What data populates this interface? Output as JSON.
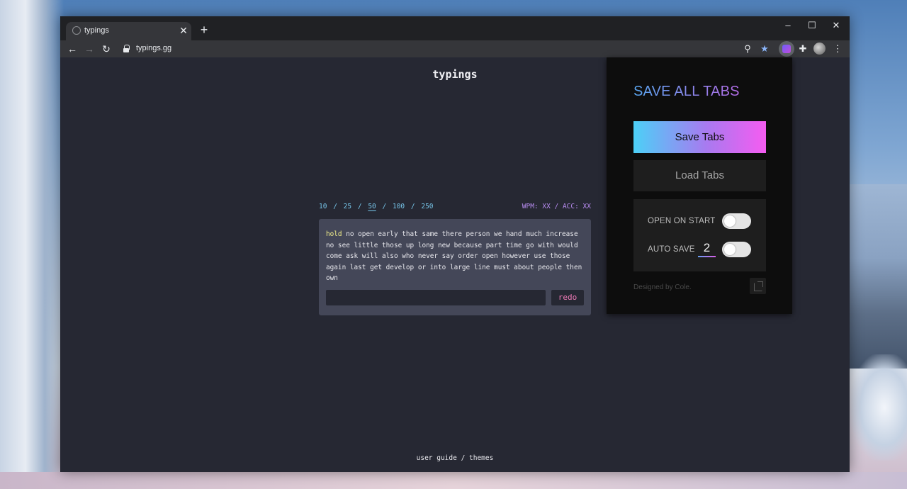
{
  "browser": {
    "tab": {
      "title": "typings",
      "close": "✕"
    },
    "new_tab": "+",
    "window_controls": {
      "minimize": "–",
      "maximize": "☐",
      "close": "✕"
    },
    "url": "typings.gg",
    "nav": {
      "back": "←",
      "forward": "→",
      "reload": "↻"
    },
    "icons": {
      "zoom": "⚲",
      "bookmark": "★",
      "extensions": "✚",
      "menu": "⋮"
    },
    "colors": {
      "bookmark_star": "#8ab4f8"
    }
  },
  "site": {
    "title": "typings",
    "word_counts": [
      "10",
      "25",
      "50",
      "100",
      "250"
    ],
    "word_count_selected": "50",
    "separator": "/",
    "stats": "WPM: XX / ACC: XX",
    "current_word": "hold",
    "prompt_rest": " no open early that same there person we hand much increase no see little those up long new because part time go with would come ask will also who never say order open however use those again last get develop or into large line must about people then own",
    "input_value": "",
    "redo_label": "redo",
    "footer": {
      "user_guide": "user guide",
      "separator": " / ",
      "themes": "themes"
    },
    "colors": {
      "background": "#262833",
      "text_box": "#444758",
      "current_word": "#f3f08c",
      "word_counts": "#77c6ea",
      "stats": "#b78cf0",
      "redo": "#f07bb8"
    }
  },
  "extension_popup": {
    "title": "SAVE ALL TABS",
    "save_button": "Save Tabs",
    "load_button": "Load Tabs",
    "settings": {
      "open_on_start": {
        "label": "OPEN ON START",
        "enabled": false
      },
      "auto_save": {
        "label": "AUTO SAVE",
        "value": "2",
        "enabled": false
      }
    },
    "footer_text": "Designed by Cole.",
    "colors": {
      "title_gradient": [
        "#59a7f2",
        "#b46be6"
      ],
      "save_gradient": [
        "#4cd0f7",
        "#a87af0",
        "#f55cf1"
      ],
      "background": "#0d0d0d"
    }
  }
}
